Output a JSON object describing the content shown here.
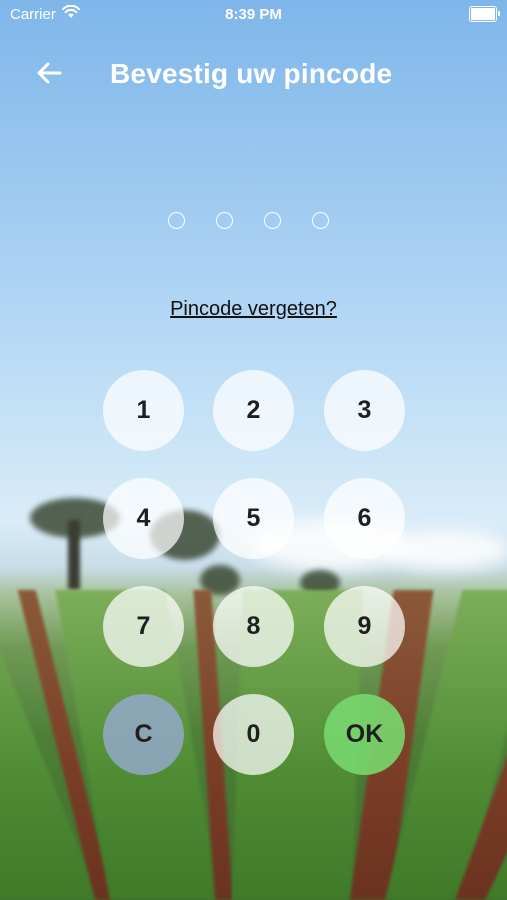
{
  "status_bar": {
    "carrier": "Carrier",
    "time": "8:39 PM"
  },
  "header": {
    "back_icon": "arrow-left-icon",
    "title": "Bevestig uw pincode"
  },
  "pin": {
    "length": 4,
    "filled": 0
  },
  "forgot_link": "Pincode vergeten?",
  "keypad": {
    "keys": [
      {
        "label": "1"
      },
      {
        "label": "2"
      },
      {
        "label": "3"
      },
      {
        "label": "4"
      },
      {
        "label": "5"
      },
      {
        "label": "6"
      },
      {
        "label": "7"
      },
      {
        "label": "8"
      },
      {
        "label": "9"
      },
      {
        "label": "C"
      },
      {
        "label": "0"
      },
      {
        "label": "OK"
      }
    ]
  },
  "colors": {
    "ok_key": "#78d76e",
    "clear_key": "#96aad2",
    "text_light": "#ffffff"
  }
}
